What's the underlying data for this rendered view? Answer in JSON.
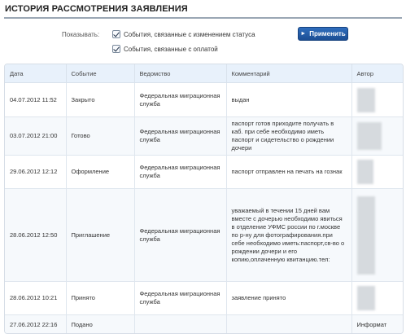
{
  "page": {
    "title": "ИСТОРИЯ РАССМОТРЕНИЯ ЗАЯВЛЕНИЯ"
  },
  "filters": {
    "label": "Показывать:",
    "status_changes": {
      "label": "События, связанные с изменением статуса",
      "checked": true
    },
    "payments": {
      "label": "События, связанные с оплатой",
      "checked": true
    },
    "apply_label": "Применить"
  },
  "table": {
    "columns": [
      "Дата",
      "Событие",
      "Ведомство",
      "Комментарий",
      "Автор"
    ],
    "rows": [
      {
        "date": "04.07.2012 11:52",
        "event": "Закрыто",
        "agency": "Федеральная миграционная служба",
        "comment": "выдан",
        "author": ""
      },
      {
        "date": "03.07.2012 21:00",
        "event": "Готово",
        "agency": "Федеральная миграционная служба",
        "comment": "паспорт готов приходите получать в каб. при себе необходимо иметь паспорт и сидетельство о рождении дочери",
        "author": ""
      },
      {
        "date": "29.06.2012 12:12",
        "event": "Оформление",
        "agency": "Федеральная миграционная служба",
        "comment": "паспорт отправлен на печать на гознак",
        "author": ""
      },
      {
        "date": "28.06.2012 12:50",
        "event": "Приглашение",
        "agency": "Федеральная миграционная служба",
        "comment": "уважаемый в течении 15 дней вам вместе с дочерью необходимо явиться в отделение УФМС россии по г.москве по р-ну для фотографирования.при себе необходимо иметь:паспорт,св-во о рождении дочери и его копию,оплаченную квитанцию.тел:",
        "author": ""
      },
      {
        "date": "28.06.2012 10:21",
        "event": "Принято",
        "agency": "Федеральная миграционная служба",
        "comment": "заявление принято",
        "author": ""
      },
      {
        "date": "27.06.2012 22:16",
        "event": "Подано",
        "agency": "",
        "comment": "",
        "author": "Информат"
      }
    ]
  },
  "colors": {
    "accent": "#1c4e93",
    "header_bg": "#e8f1fb",
    "rule": "#9aa6b4"
  }
}
